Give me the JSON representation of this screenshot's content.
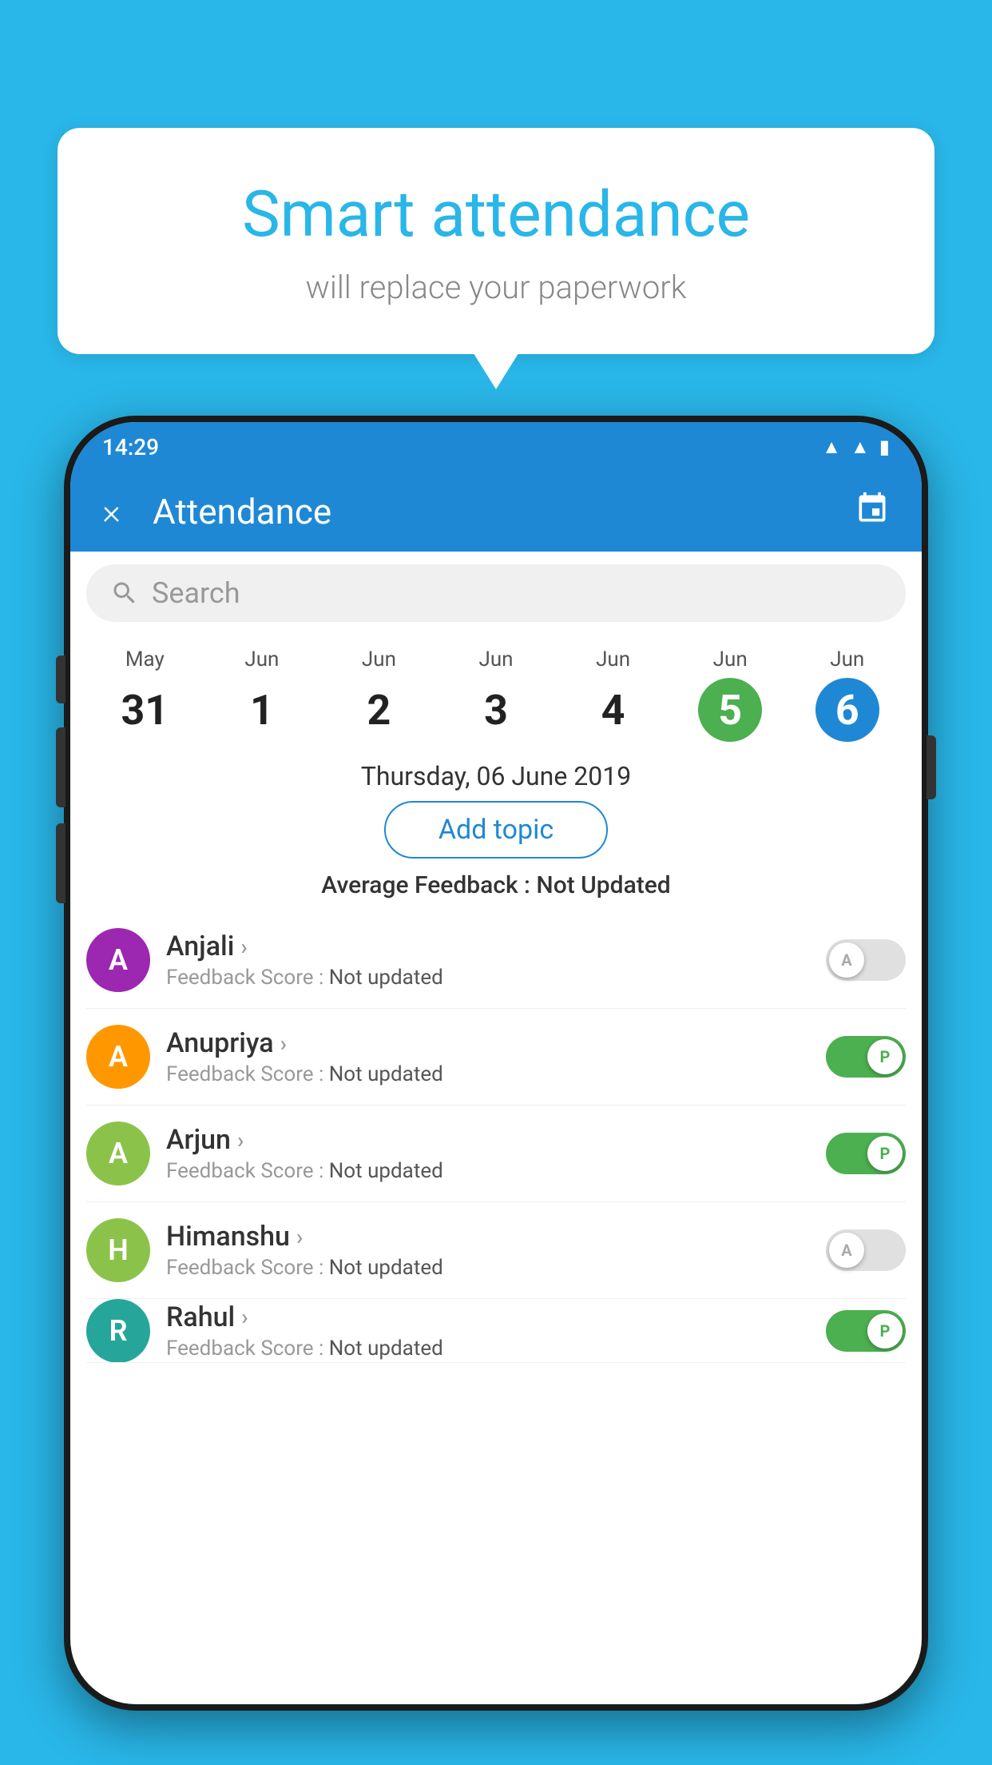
{
  "background_color": "#29B6E8",
  "speech_bubble": {
    "title": "Smart attendance",
    "subtitle": "will replace your paperwork"
  },
  "status_bar": {
    "time": "14:29",
    "icons": [
      "wifi",
      "signal",
      "battery"
    ]
  },
  "top_bar": {
    "title": "Attendance",
    "close_label": "×",
    "calendar_icon": "📅"
  },
  "search": {
    "placeholder": "Search"
  },
  "date_strip": {
    "dates": [
      {
        "month": "May",
        "day": "31",
        "selected": false
      },
      {
        "month": "Jun",
        "day": "1",
        "selected": false
      },
      {
        "month": "Jun",
        "day": "2",
        "selected": false
      },
      {
        "month": "Jun",
        "day": "3",
        "selected": false
      },
      {
        "month": "Jun",
        "day": "4",
        "selected": false
      },
      {
        "month": "Jun",
        "day": "5",
        "selected": "green"
      },
      {
        "month": "Jun",
        "day": "6",
        "selected": "blue"
      }
    ]
  },
  "selected_date": "Thursday, 06 June 2019",
  "add_topic_label": "Add topic",
  "average_feedback_label": "Average Feedback :",
  "average_feedback_value": "Not Updated",
  "students": [
    {
      "name": "Anjali",
      "avatar_letter": "A",
      "avatar_color": "purple",
      "feedback_label": "Feedback Score :",
      "feedback_value": "Not updated",
      "toggle_state": "off",
      "toggle_label": "A"
    },
    {
      "name": "Anupriya",
      "avatar_letter": "A",
      "avatar_color": "orange",
      "feedback_label": "Feedback Score :",
      "feedback_value": "Not updated",
      "toggle_state": "on",
      "toggle_label": "P"
    },
    {
      "name": "Arjun",
      "avatar_letter": "A",
      "avatar_color": "green",
      "feedback_label": "Feedback Score :",
      "feedback_value": "Not updated",
      "toggle_state": "on",
      "toggle_label": "P"
    },
    {
      "name": "Himanshu",
      "avatar_letter": "H",
      "avatar_color": "lime",
      "feedback_label": "Feedback Score :",
      "feedback_value": "Not updated",
      "toggle_state": "off",
      "toggle_label": "A"
    },
    {
      "name": "Rahul",
      "avatar_letter": "R",
      "avatar_color": "teal",
      "feedback_label": "Feedback Score :",
      "feedback_value": "Not updated",
      "toggle_state": "on",
      "toggle_label": "P"
    }
  ]
}
